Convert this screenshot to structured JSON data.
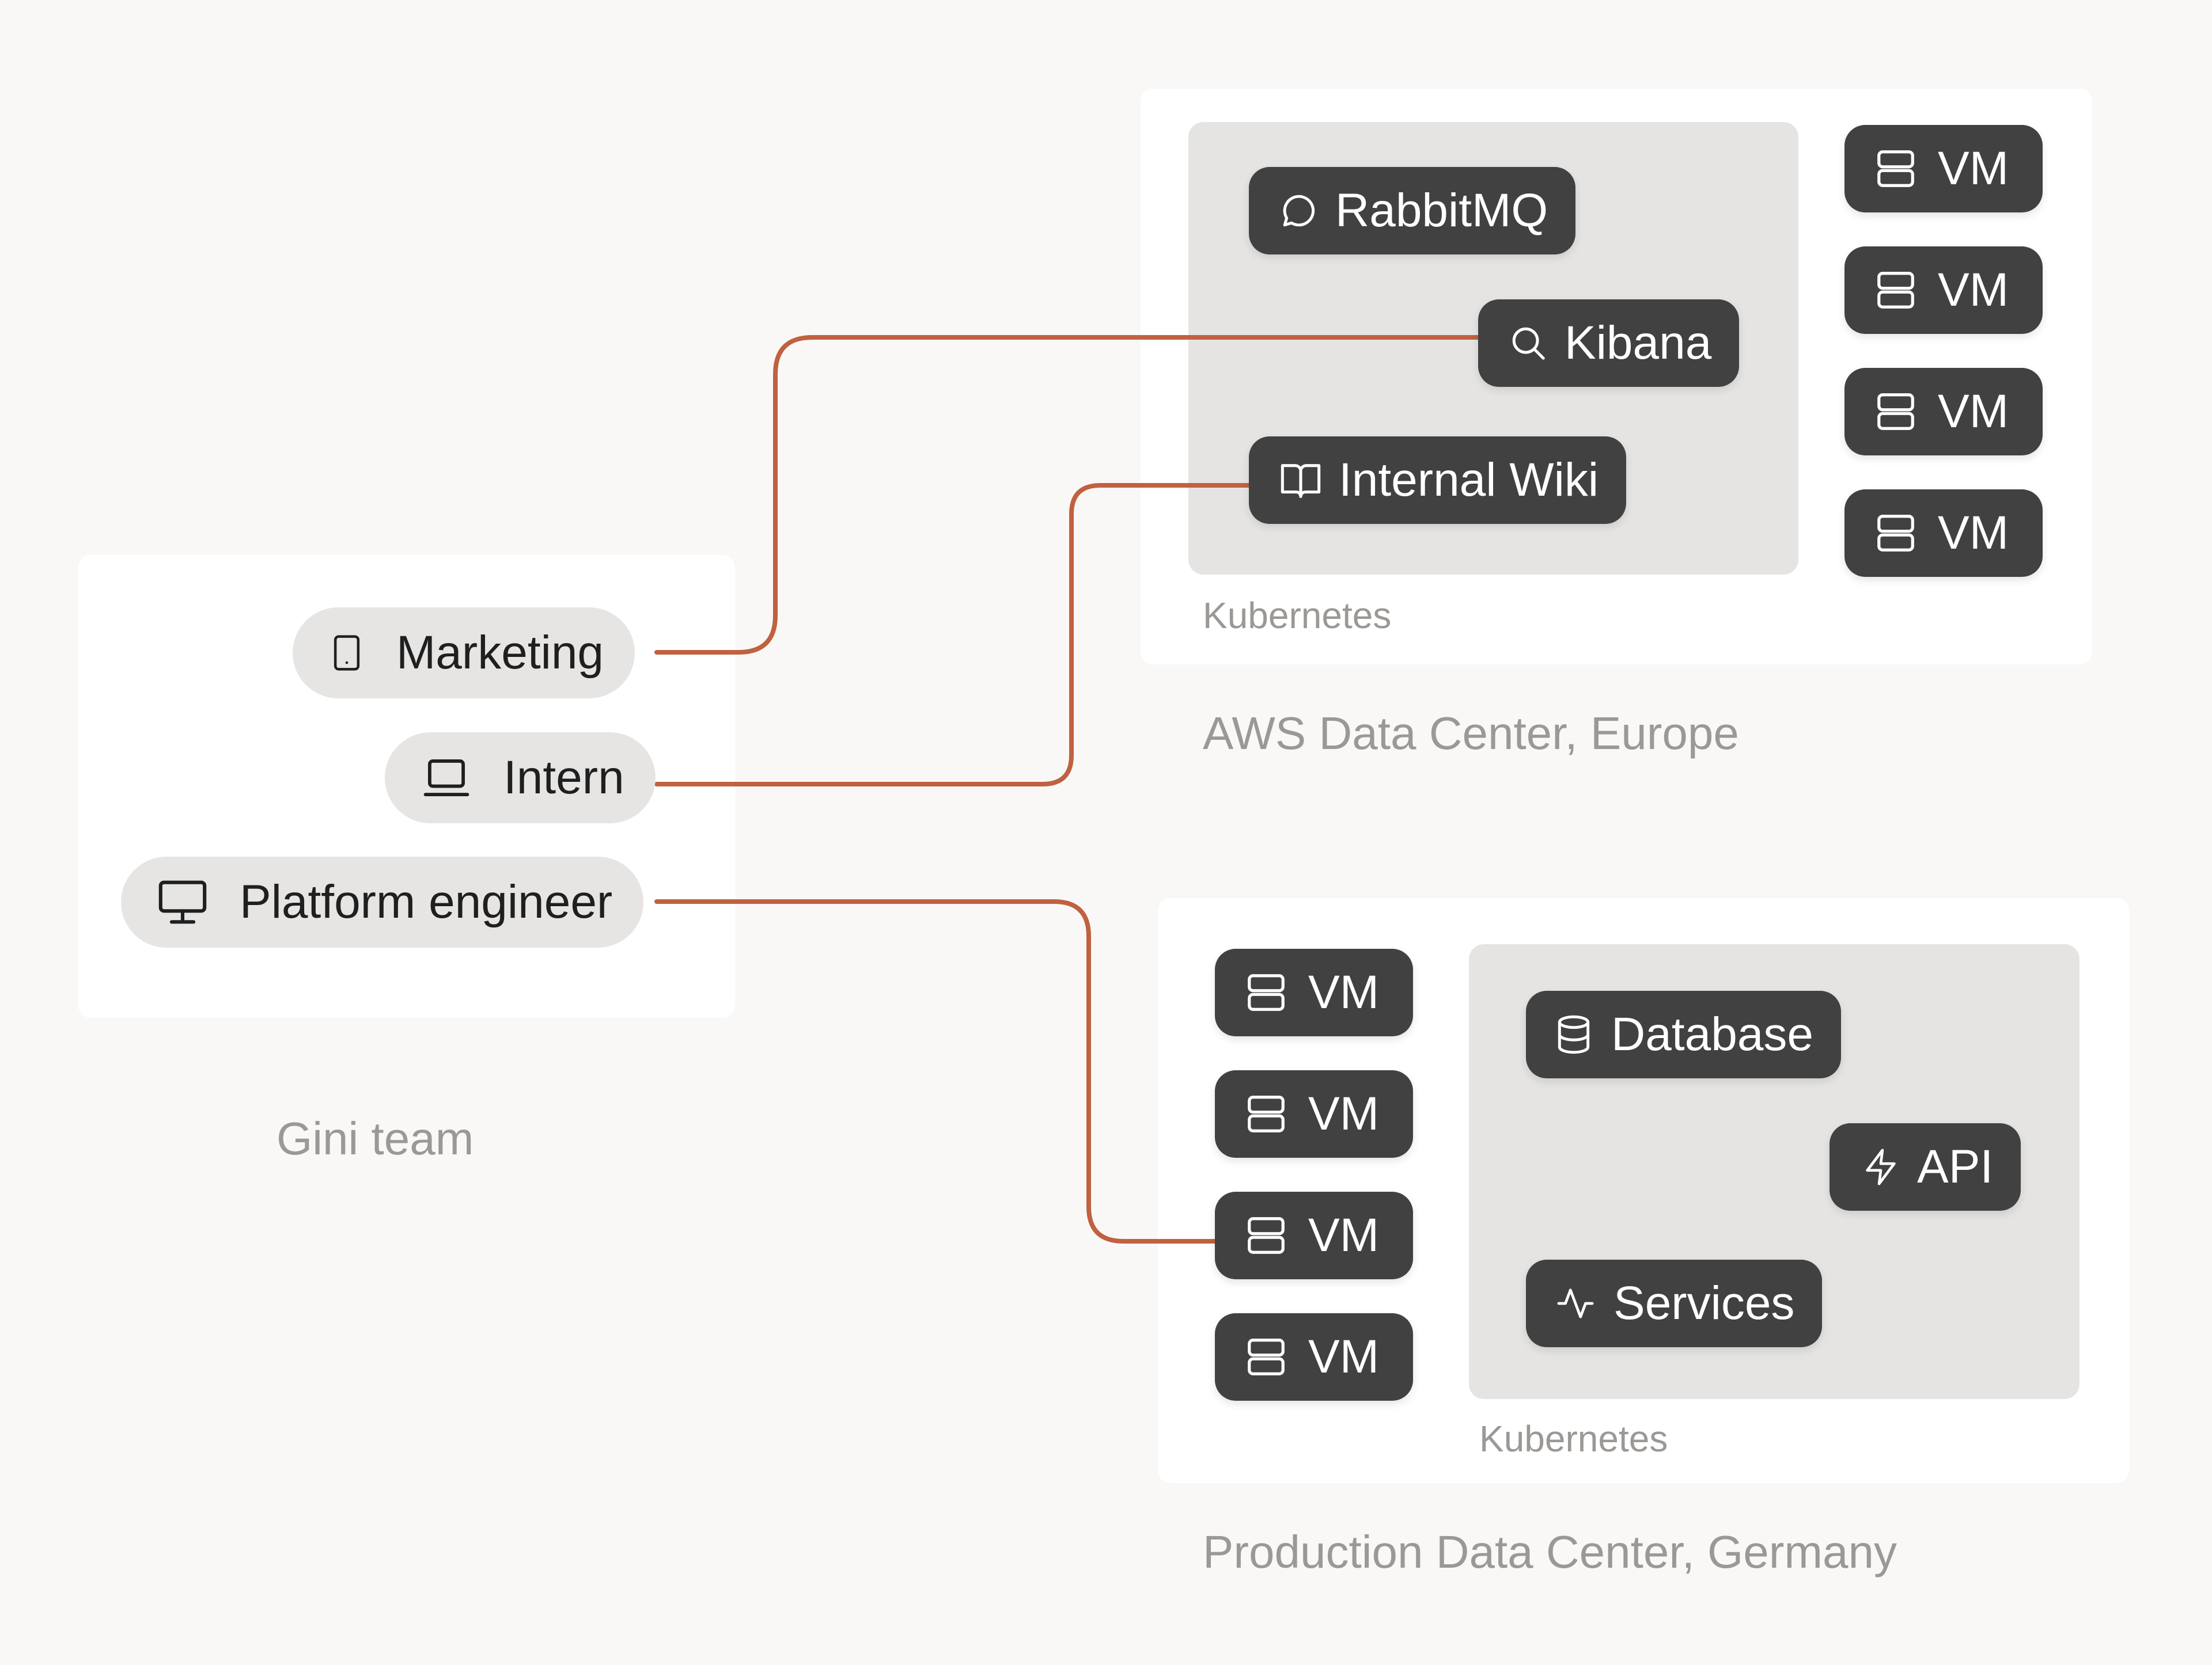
{
  "gini_team": {
    "title": "Gini team",
    "members": [
      {
        "label": "Marketing",
        "icon": "tablet-icon"
      },
      {
        "label": "Intern",
        "icon": "laptop-icon"
      },
      {
        "label": "Platform engineer",
        "icon": "monitor-icon"
      }
    ]
  },
  "aws_dc": {
    "title": "AWS Data Center, Europe",
    "kubernetes": {
      "label": "Kubernetes",
      "services": [
        {
          "label": "RabbitMQ",
          "icon": "chat-bubble-icon"
        },
        {
          "label": "Kibana",
          "icon": "search-icon"
        },
        {
          "label": "Internal Wiki",
          "icon": "book-icon"
        }
      ]
    },
    "vms": [
      "VM",
      "VM",
      "VM",
      "VM"
    ]
  },
  "prod_dc": {
    "title": "Production Data Center, Germany",
    "kubernetes": {
      "label": "Kubernetes",
      "services": [
        {
          "label": "Database",
          "icon": "database-icon"
        },
        {
          "label": "API",
          "icon": "lightning-icon"
        },
        {
          "label": "Services",
          "icon": "activity-icon"
        }
      ]
    },
    "vms": [
      "VM",
      "VM",
      "VM",
      "VM"
    ]
  },
  "connections": [
    {
      "from": "Marketing",
      "to": "Kibana"
    },
    {
      "from": "Intern",
      "to": "Internal Wiki"
    },
    {
      "from": "Platform engineer",
      "to": "VM"
    }
  ],
  "colors": {
    "background": "#f9f8f7",
    "chip": "#414141",
    "connector": "#c0613f",
    "person_pill": "#e6e5e3",
    "kubernetes_area": "#e5e4e2",
    "muted_text": "#9b9895"
  }
}
